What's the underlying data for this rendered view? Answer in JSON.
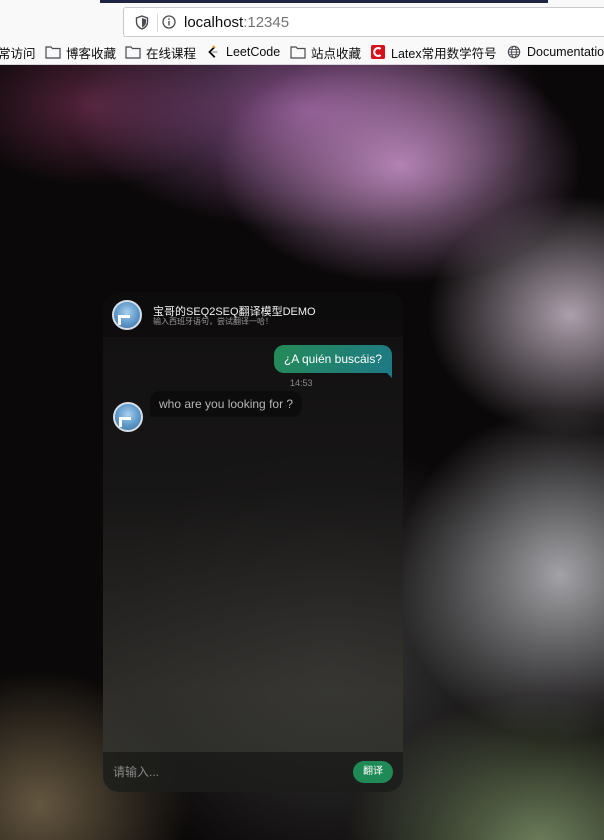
{
  "browser": {
    "url_host": "localhost",
    "url_port": ":12345",
    "bookmarks": [
      {
        "label": "常访问",
        "icon": "gear-icon"
      },
      {
        "label": "博客收藏",
        "icon": "folder-icon"
      },
      {
        "label": "在线课程",
        "icon": "folder-icon"
      },
      {
        "label": "LeetCode",
        "icon": "leetcode-icon"
      },
      {
        "label": "站点收藏",
        "icon": "folder-icon"
      },
      {
        "label": "Latex常用数学符号",
        "icon": "c-logo-icon"
      },
      {
        "label": "Documentation",
        "icon": "globe-icon"
      }
    ]
  },
  "chat": {
    "title": "宝哥的SEQ2SEQ翻译模型DEMO",
    "subtitle": "输入西班牙语句，尝试翻译一哈！",
    "messages": [
      {
        "direction": "outgoing",
        "text": "¿A quién buscáis?",
        "time": "14:53"
      },
      {
        "direction": "incoming",
        "text": "who are you looking for ?"
      }
    ],
    "input_placeholder": "请输入...",
    "send_label": "翻译"
  },
  "colors": {
    "accent": "#1f8a55",
    "outgoing_bubble": "#258a57"
  }
}
